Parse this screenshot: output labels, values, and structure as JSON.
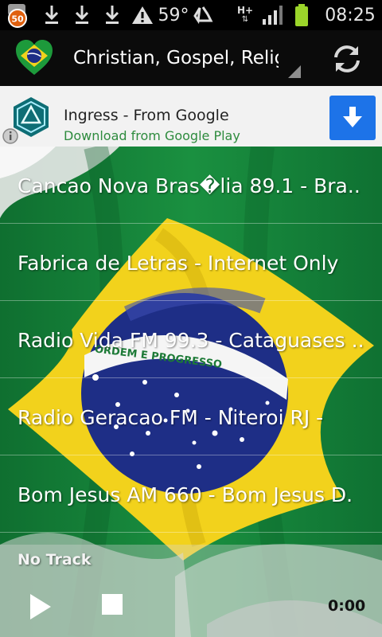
{
  "status_bar": {
    "notification_count": "50",
    "temperature": "59°",
    "network": "H+",
    "clock": "08:25"
  },
  "action_bar": {
    "title": "Christian, Gospel, Religio",
    "icons": [
      "brazil-heart-logo-icon",
      "refresh-icon"
    ]
  },
  "ad": {
    "title": "Ingress - From Google",
    "subtitle": "Download from Google Play",
    "icons": [
      "ingress-logo-icon",
      "download-arrow-icon",
      "info-icon"
    ]
  },
  "stations": [
    {
      "label": "Cancao Nova Bras�lia 89.1 -  Bra.."
    },
    {
      "label": "Fabrica de Letras  -  Internet Only"
    },
    {
      "label": "Radio Vida FM 99.3 -  Cataguases .."
    },
    {
      "label": "Radio Geracao FM  -  Niteroi  RJ  -"
    },
    {
      "label": "Bom Jesus AM 660  -  Bom Jesus D."
    }
  ],
  "flag_motto": "ORDEM E PROGRESSO",
  "player": {
    "track": "No Track",
    "time": "0:00"
  },
  "colors": {
    "flag_green": "#15823a",
    "flag_yellow": "#f2d21c",
    "flag_blue": "#1e2e86",
    "ad_download": "#1d73e8"
  }
}
